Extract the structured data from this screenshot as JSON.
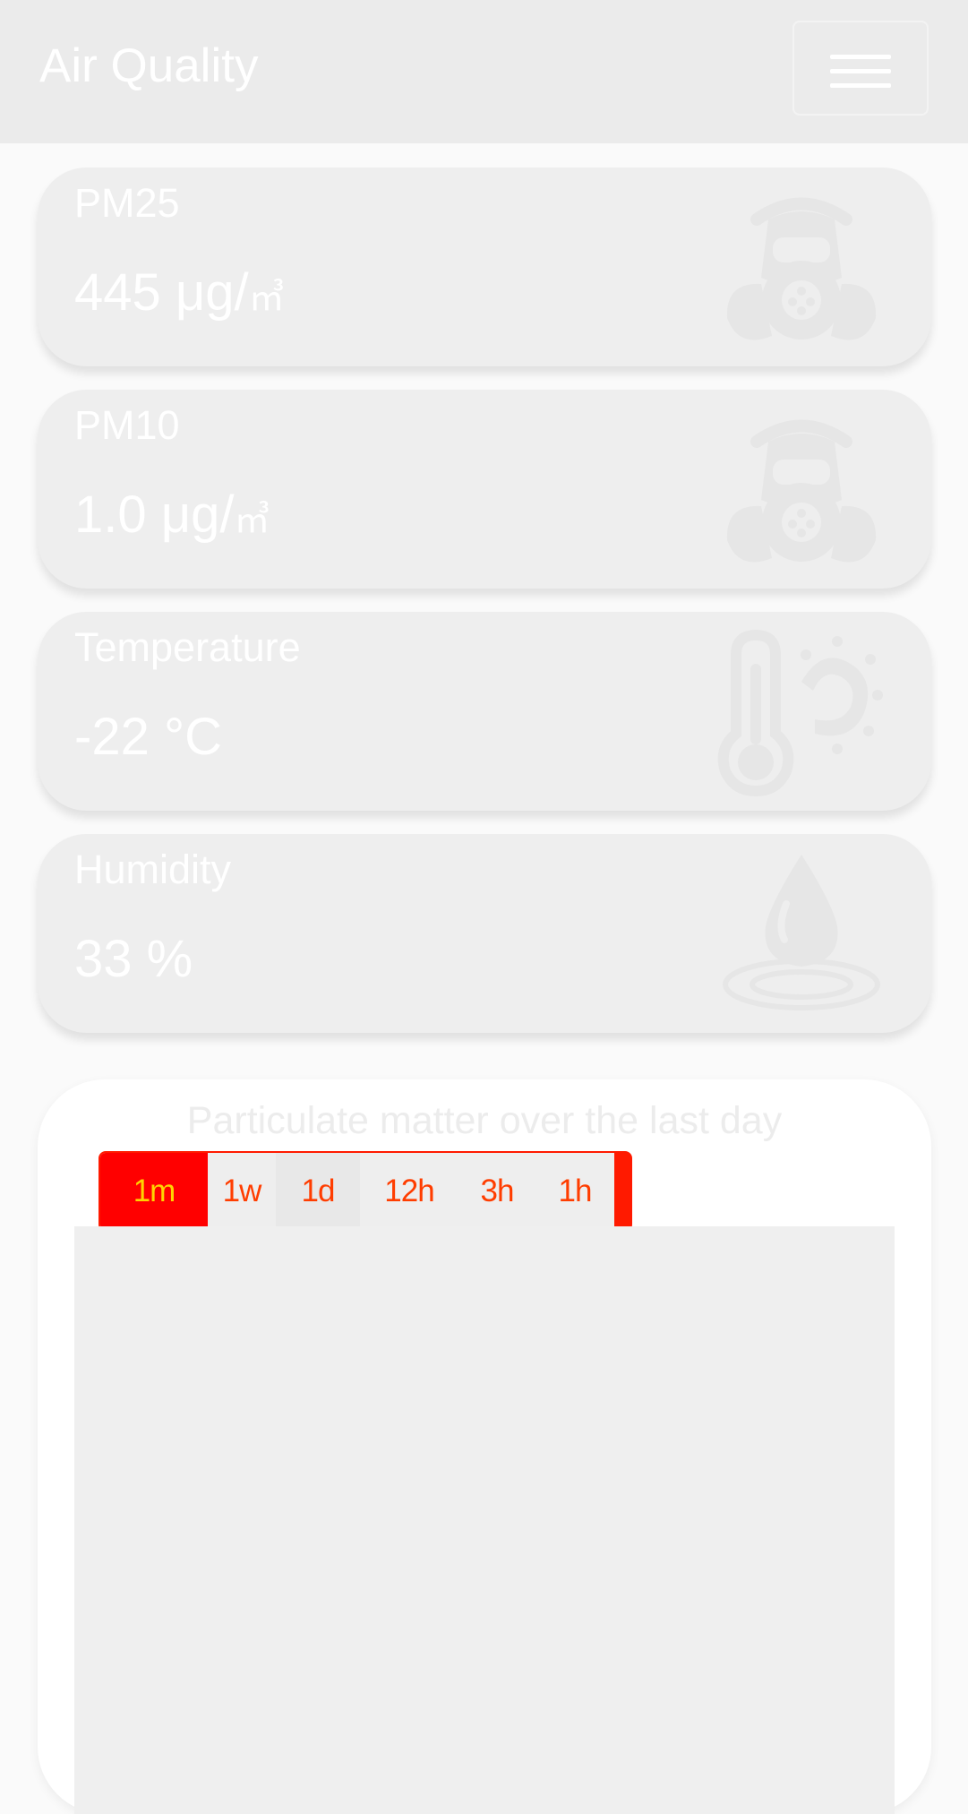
{
  "navbar": {
    "brand": "Air Quality",
    "toggler_icon": "hamburger-menu-icon"
  },
  "cards": [
    {
      "label": "PM25",
      "value": "445 μg/",
      "unit": "㎥",
      "icon": "gas-mask-icon"
    },
    {
      "label": "PM10",
      "value": "1.0 μg/",
      "unit": "㎥",
      "icon": "gas-mask-icon"
    },
    {
      "label": "Temperature",
      "value": "-22 °C",
      "unit": "",
      "icon": "thermometer-sun-icon"
    },
    {
      "label": "Humidity",
      "value": "33 %",
      "unit": "",
      "icon": "water-drop-icon"
    }
  ],
  "chart": {
    "title": "Particulate matter over the last day",
    "ranges": [
      "1m",
      "1w",
      "1d",
      "12h",
      "3h",
      "1h"
    ],
    "selected_range": "1m"
  },
  "colors": {
    "navbar_bg": "#ebebeb",
    "card_bg": "#eeeeee",
    "range_active_bg": "#ff0000",
    "range_text": "#ff3d00"
  }
}
